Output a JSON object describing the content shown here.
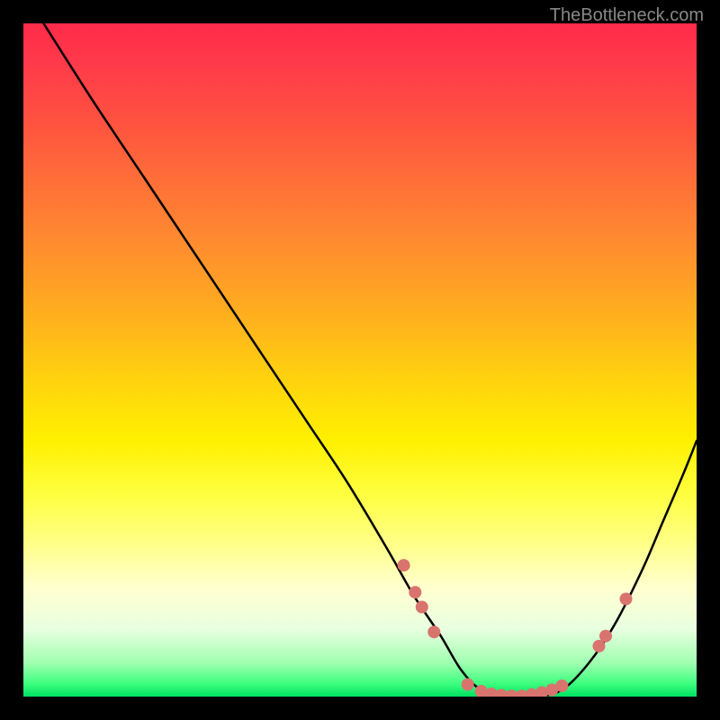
{
  "watermark": "TheBottleneck.com",
  "chart_data": {
    "type": "line",
    "title": "",
    "xlabel": "",
    "ylabel": "",
    "xlim": [
      0,
      100
    ],
    "ylim": [
      0,
      100
    ],
    "series": [
      {
        "name": "bottleneck-curve",
        "x": [
          3,
          10,
          18,
          26,
          34,
          42,
          48,
          54,
          58,
          62,
          65,
          68,
          72,
          76,
          80,
          84,
          88,
          92,
          95,
          98,
          100
        ],
        "y": [
          100,
          89,
          77,
          65,
          53,
          41,
          32,
          22,
          15,
          9,
          4,
          1,
          0,
          0,
          1,
          5,
          11,
          19,
          26,
          33,
          38
        ]
      }
    ],
    "markers": {
      "name": "highlighted-points",
      "color": "#d9736e",
      "points": [
        {
          "x": 56.5,
          "y": 19.5
        },
        {
          "x": 58.2,
          "y": 15.5
        },
        {
          "x": 59.2,
          "y": 13.3
        },
        {
          "x": 61.0,
          "y": 9.6
        },
        {
          "x": 66.0,
          "y": 1.8
        },
        {
          "x": 68.0,
          "y": 0.8
        },
        {
          "x": 69.5,
          "y": 0.4
        },
        {
          "x": 71.0,
          "y": 0.2
        },
        {
          "x": 72.5,
          "y": 0.1
        },
        {
          "x": 74.0,
          "y": 0.1
        },
        {
          "x": 75.5,
          "y": 0.3
        },
        {
          "x": 77.0,
          "y": 0.6
        },
        {
          "x": 78.5,
          "y": 1.0
        },
        {
          "x": 80.0,
          "y": 1.6
        },
        {
          "x": 85.5,
          "y": 7.5
        },
        {
          "x": 86.5,
          "y": 9.0
        },
        {
          "x": 89.5,
          "y": 14.5
        }
      ]
    },
    "gradient_stops": [
      {
        "pos": 0,
        "color": "#ff2a4a"
      },
      {
        "pos": 50,
        "color": "#ffff00"
      },
      {
        "pos": 100,
        "color": "#00e060"
      }
    ]
  }
}
